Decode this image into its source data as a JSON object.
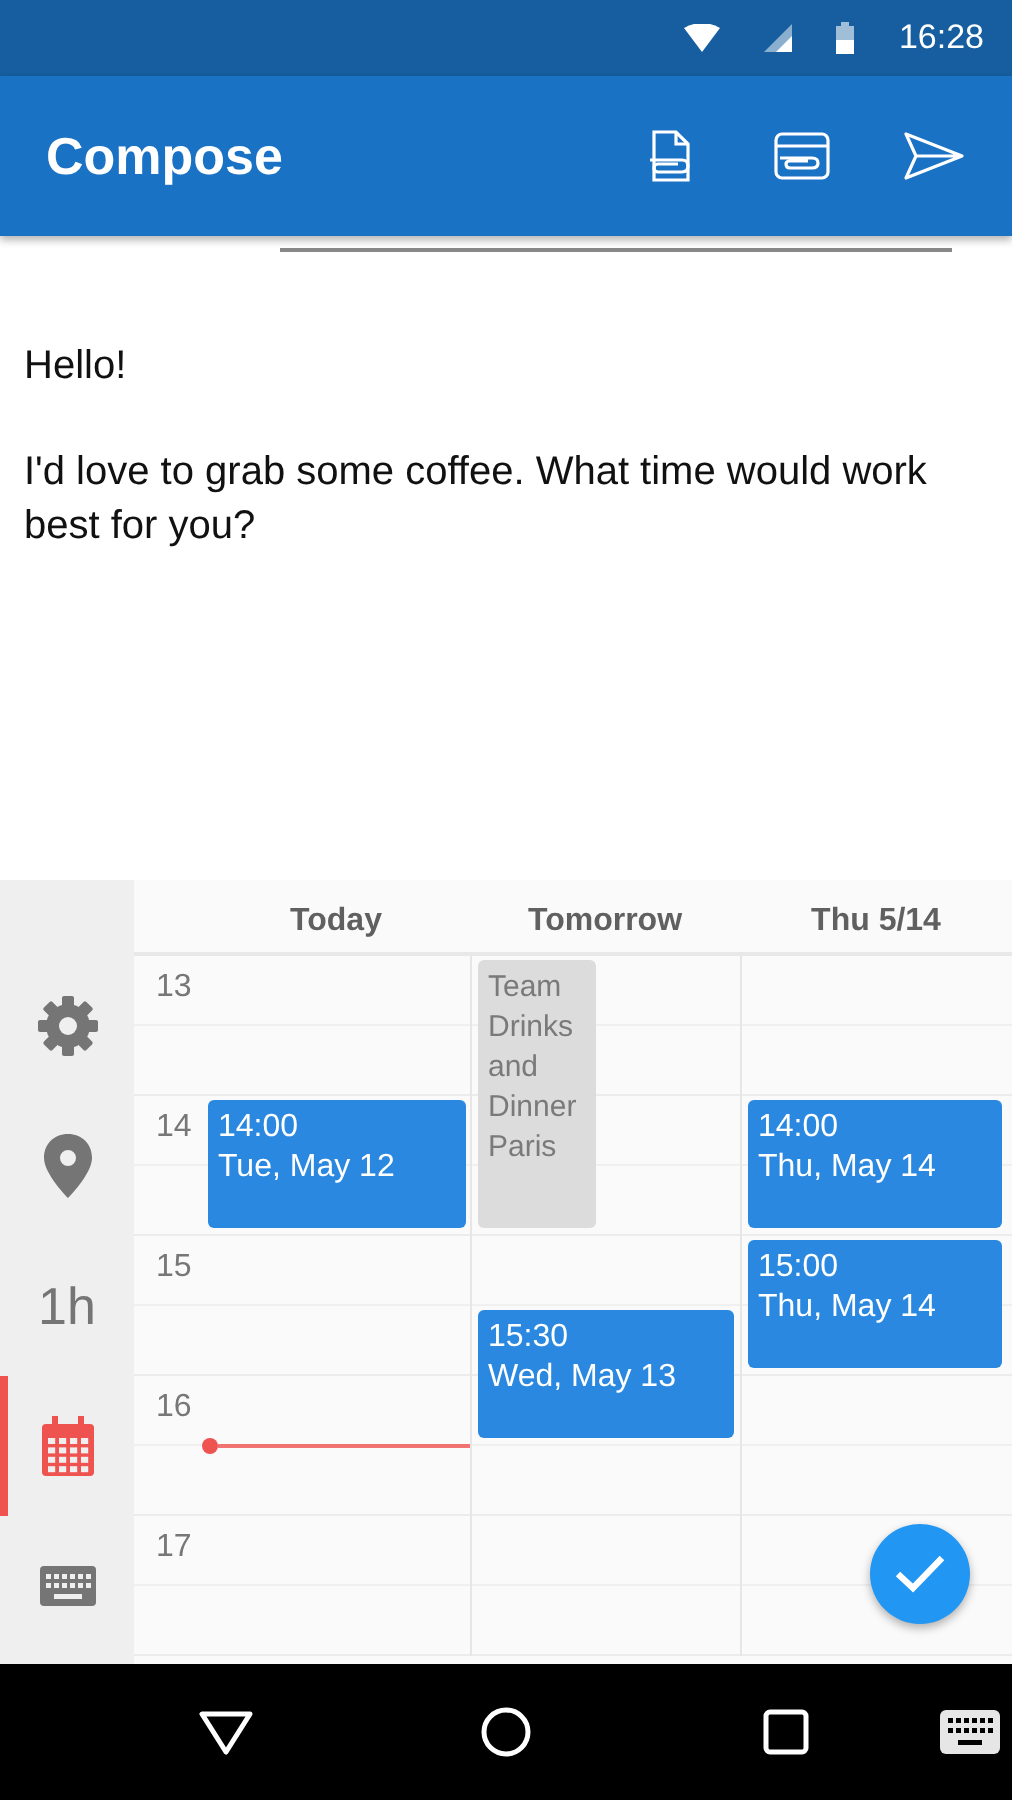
{
  "status_bar": {
    "time": "16:28"
  },
  "app_bar": {
    "title": "Compose"
  },
  "message": {
    "paragraphs": [
      "Hello!",
      "I'd love to grab some coffee. What time would work best for you?"
    ]
  },
  "sidebar": {
    "items": [
      {
        "kind": "settings",
        "selected": false
      },
      {
        "kind": "location",
        "selected": false
      },
      {
        "kind": "duration",
        "label": "1h",
        "selected": false
      },
      {
        "kind": "calendar",
        "selected": true
      },
      {
        "kind": "keyboard",
        "selected": false
      }
    ]
  },
  "calendar": {
    "hours": [
      "13",
      "14",
      "15",
      "16",
      "17"
    ],
    "days": [
      {
        "label": "Today",
        "events": [
          {
            "kind": "free",
            "time": "14:00",
            "date": "Tue, May 12"
          }
        ]
      },
      {
        "label": "Tomorrow",
        "events": [
          {
            "kind": "busy",
            "title": "Team Drinks and Dinner Paris"
          },
          {
            "kind": "free",
            "time": "15:30",
            "date": "Wed, May 13"
          }
        ]
      },
      {
        "label": "Thu 5/14",
        "events": [
          {
            "kind": "free",
            "time": "14:00",
            "date": "Thu, May 14"
          },
          {
            "kind": "free",
            "time": "15:00",
            "date": "Thu, May 14"
          }
        ]
      }
    ]
  }
}
